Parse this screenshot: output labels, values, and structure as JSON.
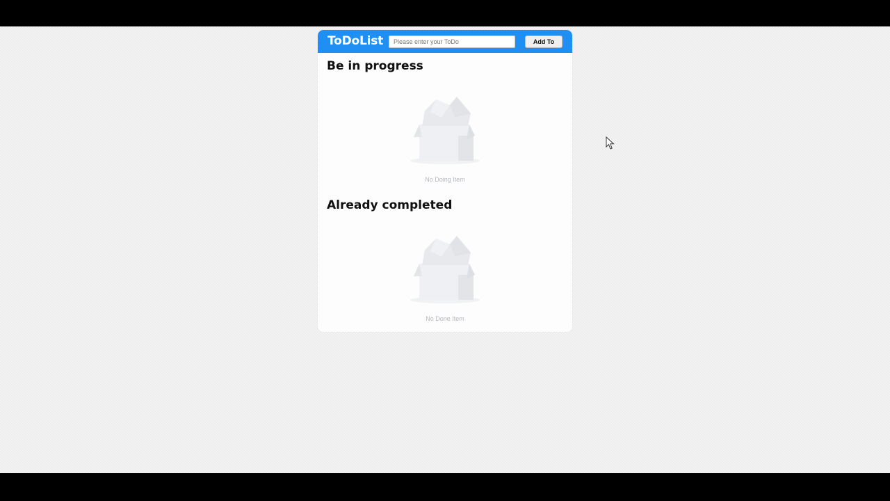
{
  "app": {
    "title": "ToDoList",
    "brand_color": "#1f8ff3"
  },
  "input": {
    "placeholder": "Please enter your ToDo",
    "value": ""
  },
  "add_button": {
    "label": "Add To"
  },
  "sections": {
    "doing": {
      "title": "Be in progress",
      "empty_text": "No Doing Item",
      "empty_icon": "empty-box-icon"
    },
    "done": {
      "title": "Already completed",
      "empty_text": "No Done Item",
      "empty_icon": "empty-box-icon"
    }
  },
  "cursor": {
    "icon": "mouse-pointer-icon"
  }
}
